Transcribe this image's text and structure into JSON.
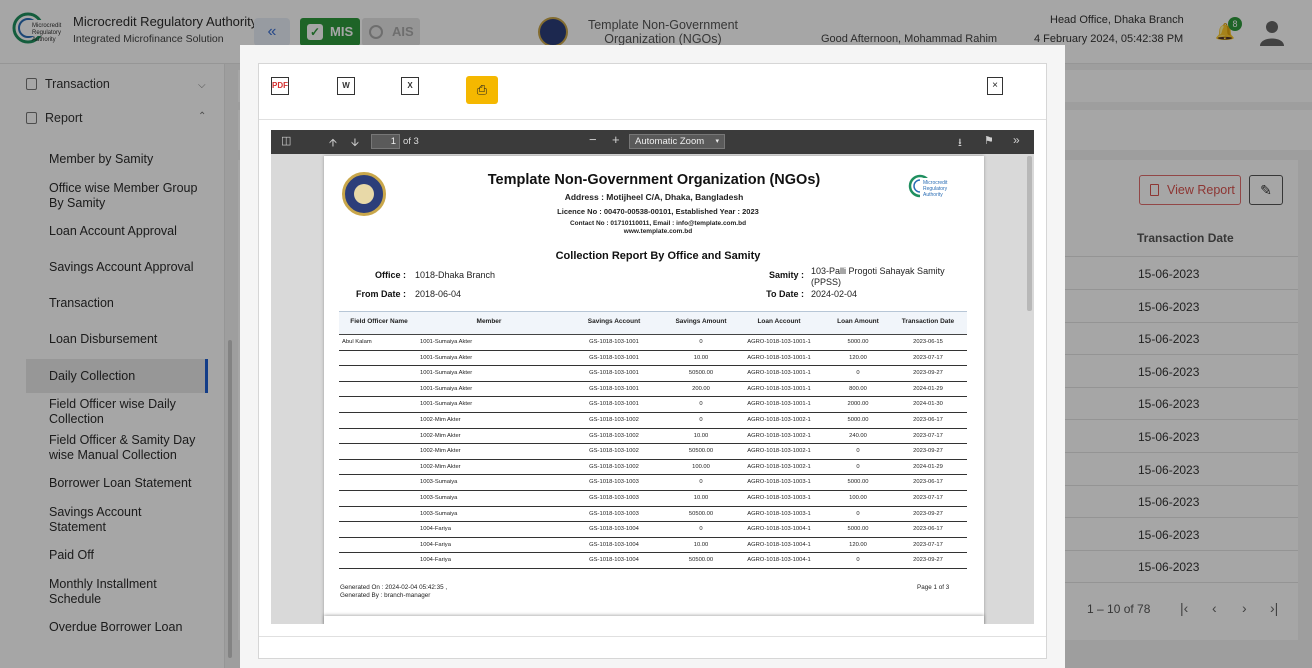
{
  "header": {
    "logo_text": [
      "Microcredit",
      "Regulatory",
      "Authority"
    ],
    "app_title": "Microcredit Regulatory Authority",
    "app_subtitle": "Integrated Microfinance Solution",
    "collapse_icon": "double-chevron-left-icon",
    "mis_label": "MIS",
    "ais_label": "AIS",
    "org_name": "Template Non-Government Organization (NGOs)",
    "greeting": "Good Afternoon, Mohammad Rahim",
    "branch": "Head Office, Dhaka Branch",
    "datetime": "4 February 2024, 05:42:38 PM",
    "notification_count": "8"
  },
  "sidebar": {
    "parents": [
      {
        "label": "Transaction",
        "expanded": false
      },
      {
        "label": "Report",
        "expanded": true
      }
    ],
    "items": [
      {
        "label": "Member by Samity"
      },
      {
        "label": "Office wise Member Group By Samity"
      },
      {
        "label": "Loan Account Approval"
      },
      {
        "label": "Savings Account Approval"
      },
      {
        "label": "Transaction"
      },
      {
        "label": "Loan Disbursement"
      },
      {
        "label": "Daily Collection",
        "active": true
      },
      {
        "label": "Field Officer wise Daily Collection"
      },
      {
        "label": "Field Officer & Samity Day wise Manual Collection"
      },
      {
        "label": "Borrower Loan Statement"
      },
      {
        "label": "Savings Account Statement"
      },
      {
        "label": "Paid Off"
      },
      {
        "label": "Monthly Installment Schedule"
      },
      {
        "label": "Overdue Borrower Loan"
      }
    ]
  },
  "background_page": {
    "view_report_label": "View Report",
    "column_header": "Transaction Date",
    "dates": [
      "15-06-2023",
      "15-06-2023",
      "15-06-2023",
      "15-06-2023",
      "15-06-2023",
      "15-06-2023",
      "15-06-2023",
      "15-06-2023",
      "15-06-2023",
      "15-06-2023"
    ],
    "paginator_text": "1 – 10 of 78"
  },
  "modal": {
    "download_pdf_icon": "pdf-file-icon",
    "download_word_icon": "word-file-icon",
    "download_excel_icon": "excel-file-icon",
    "print_icon": "printer-icon",
    "close_label": "×",
    "viewer": {
      "current_page": "1",
      "page_count_text": "of 3",
      "zoom": "Automatic Zoom",
      "zoom_minus": "−",
      "zoom_plus": "+"
    },
    "report": {
      "org_title": "Template Non-Government Organization (NGOs)",
      "address": "Address : Motijheel C/A, Dhaka, Bangladesh",
      "licence": "Licence No : 00470-00538-00101,  Established Year : 2023",
      "contact": "Contact No : 01710110011, Email : info@template.com.bd",
      "website": "www.template.com.bd",
      "report_title": "Collection Report By Office and Samity",
      "office_label": "Office :",
      "office_value": "1018-Dhaka Branch",
      "samity_label": "Samity :",
      "samity_value": "103-Palli Progoti Sahayak Samity (PPSS)",
      "from_label": "From Date :",
      "from_value": "2018-06-04",
      "to_label": "To Date :",
      "to_value": "2024-02-04",
      "columns": [
        "Field Officer Name",
        "Member",
        "Savings Account",
        "Savings Amount",
        "Loan Account",
        "Loan Amount",
        "Transaction Date"
      ],
      "rows": [
        [
          "Abul Kalam",
          "1001-Sumaiya Akter",
          "GS-1018-103-1001",
          "0",
          "AGRO-1018-103-1001-1",
          "5000.00",
          "2023-06-15"
        ],
        [
          "",
          "1001-Sumaiya Akter",
          "GS-1018-103-1001",
          "10.00",
          "AGRO-1018-103-1001-1",
          "120.00",
          "2023-07-17"
        ],
        [
          "",
          "1001-Sumaiya Akter",
          "GS-1018-103-1001",
          "50500.00",
          "AGRO-1018-103-1001-1",
          "0",
          "2023-09-27"
        ],
        [
          "",
          "1001-Sumaiya Akter",
          "GS-1018-103-1001",
          "200.00",
          "AGRO-1018-103-1001-1",
          "800.00",
          "2024-01-29"
        ],
        [
          "",
          "1001-Sumaiya Akter",
          "GS-1018-103-1001",
          "0",
          "AGRO-1018-103-1001-1",
          "2000.00",
          "2024-01-30"
        ],
        [
          "",
          "1002-Mim Akter",
          "GS-1018-103-1002",
          "0",
          "AGRO-1018-103-1002-1",
          "5000.00",
          "2023-06-17"
        ],
        [
          "",
          "1002-Mim Akter",
          "GS-1018-103-1002",
          "10.00",
          "AGRO-1018-103-1002-1",
          "240.00",
          "2023-07-17"
        ],
        [
          "",
          "1002-Mim Akter",
          "GS-1018-103-1002",
          "50500.00",
          "AGRO-1018-103-1002-1",
          "0",
          "2023-09-27"
        ],
        [
          "",
          "1002-Mim Akter",
          "GS-1018-103-1002",
          "100.00",
          "AGRO-1018-103-1002-1",
          "0",
          "2024-01-29"
        ],
        [
          "",
          "1003-Sumaiya",
          "GS-1018-103-1003",
          "0",
          "AGRO-1018-103-1003-1",
          "5000.00",
          "2023-06-17"
        ],
        [
          "",
          "1003-Sumaiya",
          "GS-1018-103-1003",
          "10.00",
          "AGRO-1018-103-1003-1",
          "100.00",
          "2023-07-17"
        ],
        [
          "",
          "1003-Sumaiya",
          "GS-1018-103-1003",
          "50500.00",
          "AGRO-1018-103-1003-1",
          "0",
          "2023-09-27"
        ],
        [
          "",
          "1004-Fariya",
          "GS-1018-103-1004",
          "0",
          "AGRO-1018-103-1004-1",
          "5000.00",
          "2023-06-17"
        ],
        [
          "",
          "1004-Fariya",
          "GS-1018-103-1004",
          "10.00",
          "AGRO-1018-103-1004-1",
          "120.00",
          "2023-07-17"
        ],
        [
          "",
          "1004-Fariya",
          "GS-1018-103-1004",
          "50500.00",
          "AGRO-1018-103-1004-1",
          "0",
          "2023-09-27"
        ]
      ],
      "generated_on": "Generated On : 2024-02-04 05:42:35 ,",
      "generated_by": "Generated By : branch-manager",
      "page_label": "Page 1 of 3"
    }
  }
}
